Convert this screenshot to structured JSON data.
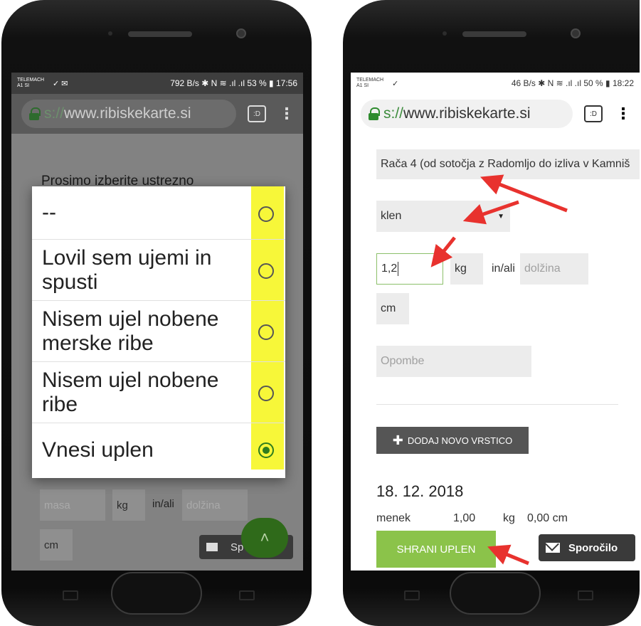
{
  "left_phone": {
    "status": {
      "carrier_line1": "TELEMACH",
      "carrier_line2": "A1 SI",
      "net_icons": "✓ ✉",
      "right": "792 B/s ✱ N ≋ .ıl .ıl 53 % ▮ 17:56"
    },
    "browser": {
      "url_scheme": "s://",
      "url_host": "www.ribiskekarte.si",
      "tab_count": ":D",
      "menu": "⋮"
    },
    "page": {
      "prompt": "Prosimo izberite ustrezno",
      "mass_placeholder": "masa",
      "kg": "kg",
      "in_ali": "in/ali",
      "length_placeholder": "dolžina",
      "cm": "cm",
      "message_partial": "Sp",
      "fab_icon": "˄"
    },
    "dialog": {
      "options": [
        {
          "label": "--",
          "selected": false
        },
        {
          "label": "Lovil sem ujemi in spusti",
          "selected": false
        },
        {
          "label": "Nisem ujel nobene merske ribe",
          "selected": false
        },
        {
          "label": "Nisem ujel nobene ribe",
          "selected": false
        },
        {
          "label": "Vnesi uplen",
          "selected": true
        }
      ],
      "highlight_color": "#f7f739",
      "radio_color": "#2e7d1e"
    }
  },
  "right_phone": {
    "status": {
      "carrier_line1": "TELEMACH",
      "carrier_line2": "A1 SI",
      "net_icons": "✓",
      "right": "46 B/s ✱ N ≋ .ıl .ıl 50 % ▮ 18:22"
    },
    "browser": {
      "url_scheme": "s://",
      "url_host": "www.ribiskekarte.si",
      "tab_count": ":D",
      "menu": "⋮"
    },
    "form": {
      "water": "Rača 4 (od sotočja z Radomljo do izliva v Kamniš",
      "species": "klen",
      "select_arrow": "▼",
      "mass_value": "1,2",
      "kg": "kg",
      "in_ali": "in/ali",
      "length_placeholder": "dolžina",
      "cm": "cm",
      "notes_placeholder": "Opombe",
      "add_row": "DODAJ NOVO VRSTICO",
      "plus_icon": "✚"
    },
    "entry": {
      "date": "18. 12. 2018",
      "species": "menek",
      "mass": "1,00",
      "kg": "kg",
      "length": "0,00 cm"
    },
    "save_button": "SHRANI UPLEN",
    "message_button": "Sporočilo",
    "colors": {
      "save": "#8bc34a",
      "arrow": "#e8322e",
      "active_border": "#8cc06a"
    }
  }
}
